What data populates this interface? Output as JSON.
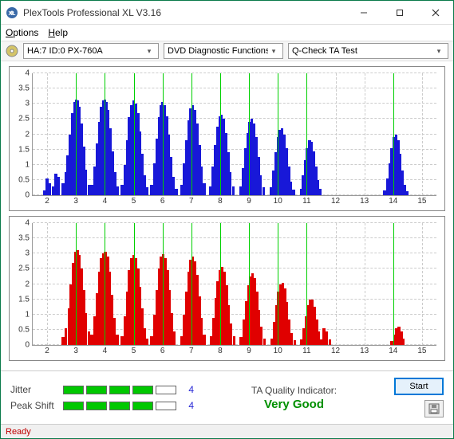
{
  "window": {
    "title": "PlexTools Professional XL V3.16"
  },
  "menu": {
    "options": "Options",
    "help": "Help"
  },
  "toolbar": {
    "drive": "HA:7 ID:0  PX-760A",
    "functions": "DVD Diagnostic Functions",
    "test": "Q-Check TA Test"
  },
  "ratings": {
    "jitter_label": "Jitter",
    "jitter_value": "4",
    "jitter_segments": 4,
    "peak_label": "Peak Shift",
    "peak_value": "4",
    "peak_segments": 4,
    "max_segments": 5
  },
  "ta": {
    "title": "TA Quality Indicator:",
    "value": "Very Good"
  },
  "buttons": {
    "start": "Start"
  },
  "status": {
    "text": "Ready"
  },
  "chart_data": [
    {
      "type": "bar",
      "color": "#1818d8",
      "title": "",
      "xlabel": "",
      "ylabel": "",
      "xlim": [
        1.5,
        15.5
      ],
      "ylim": [
        0,
        4
      ],
      "yticks": [
        0,
        0.5,
        1,
        1.5,
        2,
        2.5,
        3,
        3.5,
        4
      ],
      "xticks": [
        2,
        3,
        4,
        5,
        6,
        7,
        8,
        9,
        10,
        11,
        12,
        13,
        14,
        15
      ],
      "marks": [
        3,
        4,
        5,
        6,
        7,
        8,
        9,
        10,
        11,
        14
      ],
      "points": [
        [
          1.9,
          0.15
        ],
        [
          2.0,
          0.55
        ],
        [
          2.1,
          0.4
        ],
        [
          2.2,
          0.3
        ],
        [
          2.3,
          0.7
        ],
        [
          2.4,
          0.6
        ],
        [
          2.55,
          0.4
        ],
        [
          2.65,
          0.75
        ],
        [
          2.72,
          1.3
        ],
        [
          2.8,
          2.0
        ],
        [
          2.88,
          2.7
        ],
        [
          2.95,
          3.05
        ],
        [
          3.0,
          3.15
        ],
        [
          3.05,
          3.1
        ],
        [
          3.12,
          2.9
        ],
        [
          3.2,
          2.35
        ],
        [
          3.28,
          1.6
        ],
        [
          3.35,
          0.85
        ],
        [
          3.45,
          0.35
        ],
        [
          3.55,
          0.35
        ],
        [
          3.65,
          0.95
        ],
        [
          3.72,
          1.7
        ],
        [
          3.8,
          2.4
        ],
        [
          3.88,
          2.9
        ],
        [
          3.95,
          3.1
        ],
        [
          4.0,
          3.15
        ],
        [
          4.05,
          3.05
        ],
        [
          4.12,
          2.8
        ],
        [
          4.2,
          2.2
        ],
        [
          4.28,
          1.45
        ],
        [
          4.35,
          0.75
        ],
        [
          4.45,
          0.3
        ],
        [
          4.6,
          0.35
        ],
        [
          4.7,
          1.0
        ],
        [
          4.78,
          1.8
        ],
        [
          4.85,
          2.55
        ],
        [
          4.92,
          2.95
        ],
        [
          5.0,
          3.1
        ],
        [
          5.08,
          3.0
        ],
        [
          5.15,
          2.7
        ],
        [
          5.22,
          2.1
        ],
        [
          5.3,
          1.35
        ],
        [
          5.38,
          0.65
        ],
        [
          5.48,
          0.25
        ],
        [
          5.62,
          0.35
        ],
        [
          5.72,
          1.05
        ],
        [
          5.8,
          1.85
        ],
        [
          5.88,
          2.55
        ],
        [
          5.95,
          2.95
        ],
        [
          6.0,
          3.05
        ],
        [
          6.08,
          2.95
        ],
        [
          6.15,
          2.6
        ],
        [
          6.22,
          2.0
        ],
        [
          6.3,
          1.25
        ],
        [
          6.38,
          0.6
        ],
        [
          6.48,
          0.22
        ],
        [
          6.65,
          0.35
        ],
        [
          6.75,
          1.05
        ],
        [
          6.82,
          1.8
        ],
        [
          6.9,
          2.45
        ],
        [
          6.98,
          2.85
        ],
        [
          7.05,
          2.95
        ],
        [
          7.12,
          2.8
        ],
        [
          7.2,
          2.35
        ],
        [
          7.28,
          1.65
        ],
        [
          7.35,
          0.95
        ],
        [
          7.45,
          0.4
        ],
        [
          7.65,
          0.3
        ],
        [
          7.75,
          0.95
        ],
        [
          7.82,
          1.65
        ],
        [
          7.9,
          2.25
        ],
        [
          7.98,
          2.6
        ],
        [
          8.05,
          2.65
        ],
        [
          8.12,
          2.5
        ],
        [
          8.2,
          2.05
        ],
        [
          8.28,
          1.4
        ],
        [
          8.35,
          0.75
        ],
        [
          8.45,
          0.3
        ],
        [
          8.7,
          0.3
        ],
        [
          8.8,
          0.9
        ],
        [
          8.88,
          1.55
        ],
        [
          8.95,
          2.05
        ],
        [
          9.02,
          2.4
        ],
        [
          9.1,
          2.5
        ],
        [
          9.18,
          2.35
        ],
        [
          9.25,
          1.9
        ],
        [
          9.33,
          1.25
        ],
        [
          9.4,
          0.65
        ],
        [
          9.5,
          0.25
        ],
        [
          9.75,
          0.25
        ],
        [
          9.85,
          0.8
        ],
        [
          9.92,
          1.4
        ],
        [
          10.0,
          1.9
        ],
        [
          10.08,
          2.15
        ],
        [
          10.15,
          2.2
        ],
        [
          10.22,
          2.0
        ],
        [
          10.3,
          1.55
        ],
        [
          10.38,
          0.95
        ],
        [
          10.45,
          0.45
        ],
        [
          10.55,
          0.18
        ],
        [
          10.8,
          0.2
        ],
        [
          10.88,
          0.65
        ],
        [
          10.95,
          1.15
        ],
        [
          11.02,
          1.55
        ],
        [
          11.1,
          1.8
        ],
        [
          11.18,
          1.75
        ],
        [
          11.25,
          1.45
        ],
        [
          11.32,
          0.95
        ],
        [
          11.4,
          0.5
        ],
        [
          11.48,
          0.2
        ],
        [
          13.7,
          0.15
        ],
        [
          13.8,
          0.55
        ],
        [
          13.88,
          1.05
        ],
        [
          13.95,
          1.55
        ],
        [
          14.02,
          1.9
        ],
        [
          14.1,
          2.0
        ],
        [
          14.18,
          1.8
        ],
        [
          14.25,
          1.35
        ],
        [
          14.32,
          0.8
        ],
        [
          14.4,
          0.35
        ],
        [
          14.5,
          0.12
        ]
      ]
    },
    {
      "type": "bar",
      "color": "#e00000",
      "title": "",
      "xlabel": "",
      "ylabel": "",
      "xlim": [
        1.5,
        15.5
      ],
      "ylim": [
        0,
        4
      ],
      "yticks": [
        0,
        0.5,
        1,
        1.5,
        2,
        2.5,
        3,
        3.5,
        4
      ],
      "xticks": [
        2,
        3,
        4,
        5,
        6,
        7,
        8,
        9,
        10,
        11,
        12,
        13,
        14,
        15
      ],
      "marks": [
        3,
        4,
        5,
        6,
        7,
        8,
        9,
        10,
        11,
        14
      ],
      "points": [
        [
          2.55,
          0.25
        ],
        [
          2.65,
          0.55
        ],
        [
          2.75,
          1.2
        ],
        [
          2.82,
          2.0
        ],
        [
          2.9,
          2.7
        ],
        [
          2.98,
          3.05
        ],
        [
          3.05,
          3.1
        ],
        [
          3.12,
          2.95
        ],
        [
          3.2,
          2.5
        ],
        [
          3.28,
          1.8
        ],
        [
          3.35,
          1.05
        ],
        [
          3.45,
          0.45
        ],
        [
          3.55,
          0.35
        ],
        [
          3.65,
          0.95
        ],
        [
          3.72,
          1.7
        ],
        [
          3.8,
          2.4
        ],
        [
          3.88,
          2.85
        ],
        [
          3.95,
          3.0
        ],
        [
          4.02,
          3.05
        ],
        [
          4.1,
          2.9
        ],
        [
          4.18,
          2.4
        ],
        [
          4.25,
          1.65
        ],
        [
          4.33,
          0.9
        ],
        [
          4.43,
          0.35
        ],
        [
          4.6,
          0.3
        ],
        [
          4.7,
          0.95
        ],
        [
          4.78,
          1.75
        ],
        [
          4.85,
          2.45
        ],
        [
          4.92,
          2.85
        ],
        [
          5.0,
          2.95
        ],
        [
          5.08,
          2.85
        ],
        [
          5.15,
          2.5
        ],
        [
          5.22,
          1.9
        ],
        [
          5.3,
          1.2
        ],
        [
          5.38,
          0.55
        ],
        [
          5.48,
          0.22
        ],
        [
          5.62,
          0.3
        ],
        [
          5.72,
          1.0
        ],
        [
          5.8,
          1.8
        ],
        [
          5.88,
          2.5
        ],
        [
          5.95,
          2.9
        ],
        [
          6.02,
          2.98
        ],
        [
          6.1,
          2.85
        ],
        [
          6.18,
          2.45
        ],
        [
          6.25,
          1.8
        ],
        [
          6.33,
          1.05
        ],
        [
          6.42,
          0.45
        ],
        [
          6.65,
          0.3
        ],
        [
          6.75,
          1.0
        ],
        [
          6.82,
          1.75
        ],
        [
          6.9,
          2.4
        ],
        [
          6.98,
          2.8
        ],
        [
          7.05,
          2.9
        ],
        [
          7.12,
          2.75
        ],
        [
          7.2,
          2.3
        ],
        [
          7.28,
          1.6
        ],
        [
          7.35,
          0.9
        ],
        [
          7.45,
          0.35
        ],
        [
          7.68,
          0.28
        ],
        [
          7.78,
          0.9
        ],
        [
          7.85,
          1.55
        ],
        [
          7.92,
          2.1
        ],
        [
          8.0,
          2.45
        ],
        [
          8.08,
          2.55
        ],
        [
          8.15,
          2.4
        ],
        [
          8.22,
          1.95
        ],
        [
          8.3,
          1.3
        ],
        [
          8.38,
          0.7
        ],
        [
          8.48,
          0.28
        ],
        [
          8.72,
          0.25
        ],
        [
          8.82,
          0.85
        ],
        [
          8.9,
          1.45
        ],
        [
          8.98,
          1.95
        ],
        [
          9.05,
          2.25
        ],
        [
          9.12,
          2.35
        ],
        [
          9.2,
          2.2
        ],
        [
          9.28,
          1.75
        ],
        [
          9.35,
          1.15
        ],
        [
          9.43,
          0.6
        ],
        [
          9.53,
          0.22
        ],
        [
          9.78,
          0.22
        ],
        [
          9.88,
          0.75
        ],
        [
          9.95,
          1.3
        ],
        [
          10.02,
          1.75
        ],
        [
          10.1,
          2.0
        ],
        [
          10.18,
          2.05
        ],
        [
          10.25,
          1.85
        ],
        [
          10.32,
          1.4
        ],
        [
          10.4,
          0.85
        ],
        [
          10.48,
          0.4
        ],
        [
          10.58,
          0.15
        ],
        [
          10.82,
          0.18
        ],
        [
          10.9,
          0.55
        ],
        [
          10.98,
          0.95
        ],
        [
          11.05,
          1.3
        ],
        [
          11.12,
          1.5
        ],
        [
          11.2,
          1.5
        ],
        [
          11.28,
          1.25
        ],
        [
          11.35,
          0.85
        ],
        [
          11.42,
          0.45
        ],
        [
          11.5,
          0.18
        ],
        [
          11.6,
          0.55
        ],
        [
          11.7,
          0.45
        ],
        [
          11.8,
          0.18
        ],
        [
          13.95,
          0.12
        ],
        [
          14.05,
          0.35
        ],
        [
          14.12,
          0.55
        ],
        [
          14.2,
          0.6
        ],
        [
          14.28,
          0.45
        ],
        [
          14.35,
          0.22
        ]
      ]
    }
  ]
}
